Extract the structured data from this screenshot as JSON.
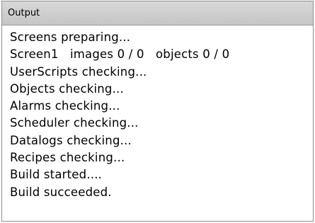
{
  "panel": {
    "title": "Output"
  },
  "output": {
    "lines": [
      "Screens preparing...",
      "Screen1   images 0 / 0   objects 0 / 0",
      "UserScripts checking...",
      "Objects checking...",
      "Alarms checking...",
      "Scheduler checking...",
      "Datalogs checking...",
      "Recipes checking...",
      "Build started....",
      "Build succeeded."
    ]
  }
}
